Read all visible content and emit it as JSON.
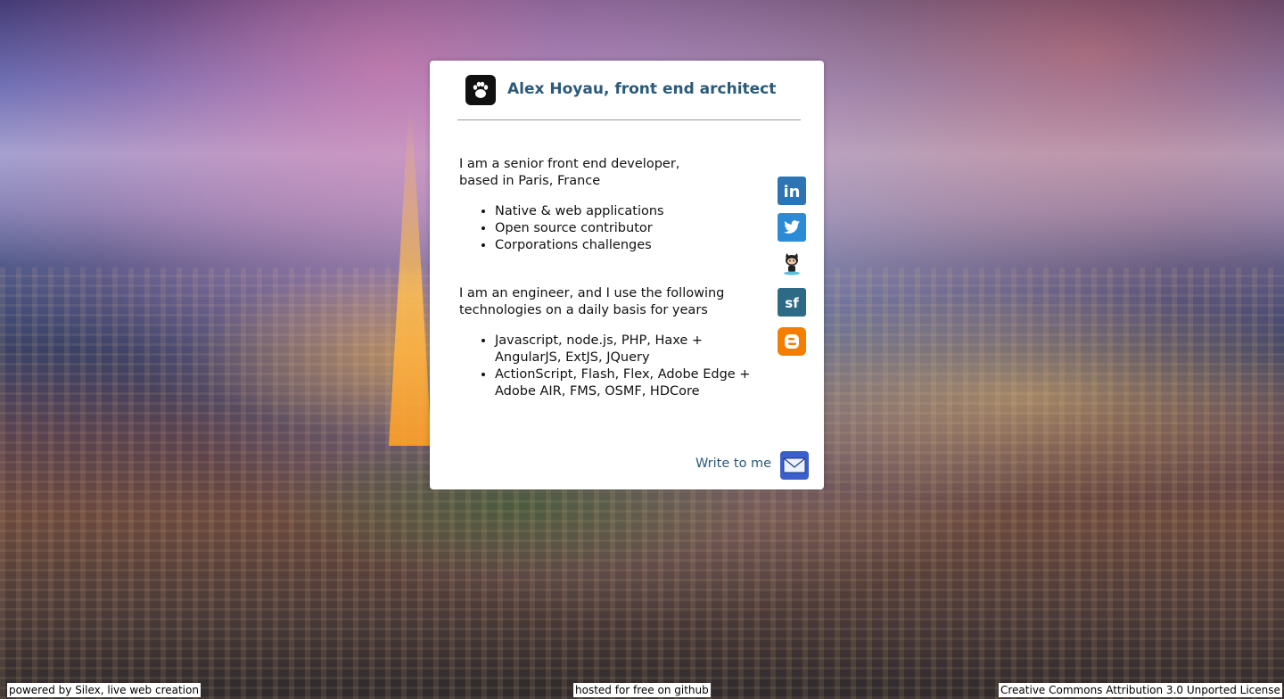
{
  "header": {
    "title": "Alex Hoyau, front end architect",
    "logo_icon": "paw-icon"
  },
  "about": {
    "intro_line1": "I am a senior front end developer,",
    "intro_line2": "based in Paris, France",
    "skills": [
      "Native & web applications",
      "Open source contributor",
      "Corporations challenges"
    ],
    "engineer_line1": "I am an engineer, and I use the following",
    "engineer_line2": "technologies on a daily basis for years",
    "tech": [
      {
        "line1": "Javascript, node.js, PHP, Haxe +",
        "line2": "AngularJS, ExtJS, JQuery"
      },
      {
        "line1": "ActionScript, Flash, Flex, Adobe Edge +",
        "line2": "Adobe AIR, FMS, OSMF, HDCore"
      }
    ]
  },
  "social": [
    {
      "icon": "linkedin-icon",
      "label": "in",
      "color": "#2c74b3"
    },
    {
      "icon": "twitter-icon",
      "label": "",
      "color": "#2c8bd6"
    },
    {
      "icon": "github-icon",
      "label": "",
      "color": "#222222"
    },
    {
      "icon": "sourceforge-icon",
      "label": "sf",
      "color": "#2c6a86"
    },
    {
      "icon": "blogger-icon",
      "label": "B",
      "color": "#f57d00"
    }
  ],
  "contact": {
    "write_label": "Write to me",
    "mail_icon": "mail-icon"
  },
  "footer": {
    "powered_prefix": "powered by ",
    "powered_link": "Silex, live web creation",
    "hosted": "hosted for free on github",
    "license": "Creative Commons Attribution 3.0 Unported License"
  },
  "colors": {
    "title": "#2a5a7a",
    "card_bg": "#ffffff"
  }
}
